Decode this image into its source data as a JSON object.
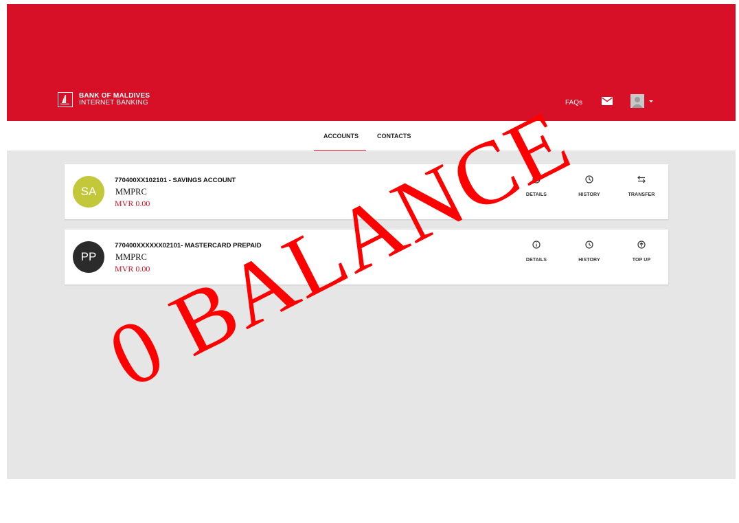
{
  "header": {
    "bank_name": "BANK OF MALDIVES",
    "product": "INTERNET BANKING",
    "faqs": "FAQs",
    "icons": [
      "mail-icon",
      "user-avatar-icon",
      "caret-down-icon"
    ],
    "brand_color": "#d70f27"
  },
  "nav": {
    "tabs": [
      {
        "label": "ACCOUNTS",
        "active": true
      },
      {
        "label": "CONTACTS",
        "active": false
      }
    ]
  },
  "accounts": [
    {
      "initials": "SA",
      "circle_color": "#c2c83a",
      "title": "770400XX102101  - SAVINGS ACCOUNT",
      "name": "MMPRC",
      "balance": "MVR 0.00",
      "actions": [
        {
          "label": "DETAILS",
          "icon": "info-icon"
        },
        {
          "label": "HISTORY",
          "icon": "clock-icon"
        },
        {
          "label": "TRANSFER",
          "icon": "transfer-arrows-icon"
        }
      ]
    },
    {
      "initials": "PP",
      "circle_color": "#2b2b2b",
      "title": "770400XXXXXX02101- MASTERCARD PREPAID",
      "name": "MMPRC",
      "balance": "MVR 0.00",
      "actions": [
        {
          "label": "DETAILS",
          "icon": "info-icon"
        },
        {
          "label": "HISTORY",
          "icon": "clock-icon"
        },
        {
          "label": "TOP UP",
          "icon": "arrow-up-circle-icon"
        }
      ]
    }
  ],
  "overlay": {
    "text": "0 BALANCE",
    "color": "#ff0000"
  }
}
